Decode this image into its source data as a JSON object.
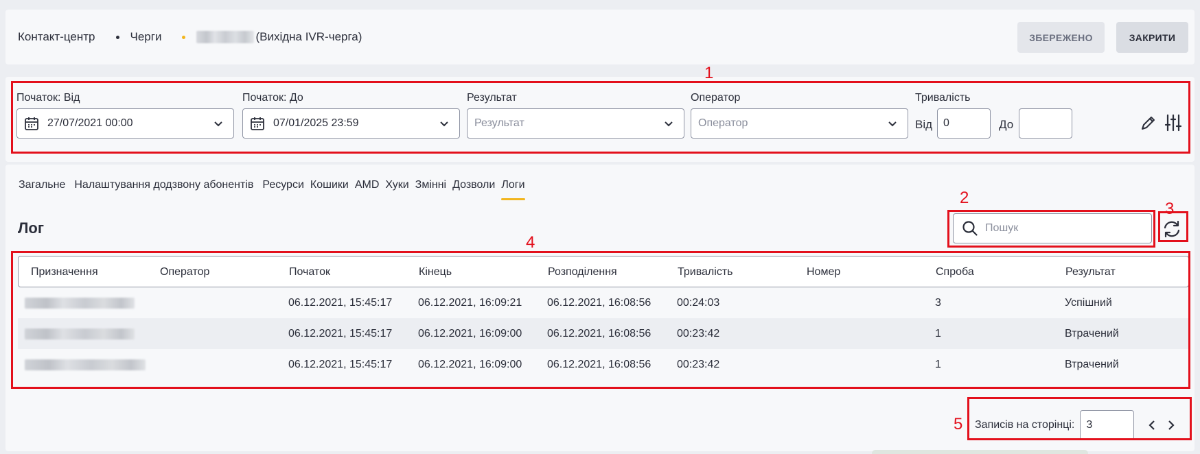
{
  "header": {
    "breadcrumb": [
      {
        "label": "Контакт-центр"
      },
      {
        "label": "Черги",
        "sep_color": "#2b2e3a"
      },
      {
        "label": "(Вихідна IVR-черга)",
        "sep_color": "#f2b51d"
      }
    ],
    "saved_label": "ЗБЕРЕЖЕНО",
    "close_label": "ЗАКРИТИ"
  },
  "filters": {
    "start_from_label": "Початок: Від",
    "start_from_value": "27/07/2021 00:00",
    "start_to_label": "Початок: До",
    "start_to_value": "07/01/2025 23:59",
    "result_label": "Результат",
    "result_placeholder": "Результат",
    "operator_label": "Оператор",
    "operator_placeholder": "Оператор",
    "duration_label": "Тривалість",
    "duration_from_label": "Від",
    "duration_from_value": "0",
    "duration_to_label": "До",
    "duration_to_value": ""
  },
  "tabs": [
    {
      "label": "Загальне"
    },
    {
      "label": "Налаштування додзвону абонентів"
    },
    {
      "label": "Ресурси"
    },
    {
      "label": "Кошики"
    },
    {
      "label": "AMD"
    },
    {
      "label": "Хуки"
    },
    {
      "label": "Змінні"
    },
    {
      "label": "Дозволи"
    },
    {
      "label": "Логи",
      "active": true
    }
  ],
  "log": {
    "title": "Лог",
    "search_placeholder": "Пошук",
    "columns": [
      "Призначення",
      "Оператор",
      "Початок",
      "Кінець",
      "Розподілення",
      "Тривалість",
      "Номер",
      "Спроба",
      "Результат"
    ],
    "rows": [
      [
        "",
        "",
        "06.12.2021, 15:45:17",
        "06.12.2021, 16:09:21",
        "06.12.2021, 16:08:56",
        "00:24:03",
        "",
        "3",
        "Успішний"
      ],
      [
        "",
        "",
        "06.12.2021, 15:45:17",
        "06.12.2021, 16:09:00",
        "06.12.2021, 16:08:56",
        "00:23:42",
        "",
        "1",
        "Втрачений"
      ],
      [
        "",
        "",
        "06.12.2021, 15:45:17",
        "06.12.2021, 16:09:00",
        "06.12.2021, 16:08:56",
        "00:23:42",
        "",
        "1",
        "Втрачений"
      ]
    ]
  },
  "pagination": {
    "label": "Записів на сторінці:",
    "value": "3"
  },
  "annotations": [
    "1",
    "2",
    "3",
    "4",
    "5"
  ],
  "colors": {
    "accent": "#f2b51d",
    "annotation_red": "#e3101c"
  },
  "icons": [
    "calendar-icon",
    "chevron-down-icon",
    "pencil-icon",
    "sliders-icon",
    "search-icon",
    "refresh-icon",
    "chevron-left-icon",
    "chevron-right-icon"
  ]
}
